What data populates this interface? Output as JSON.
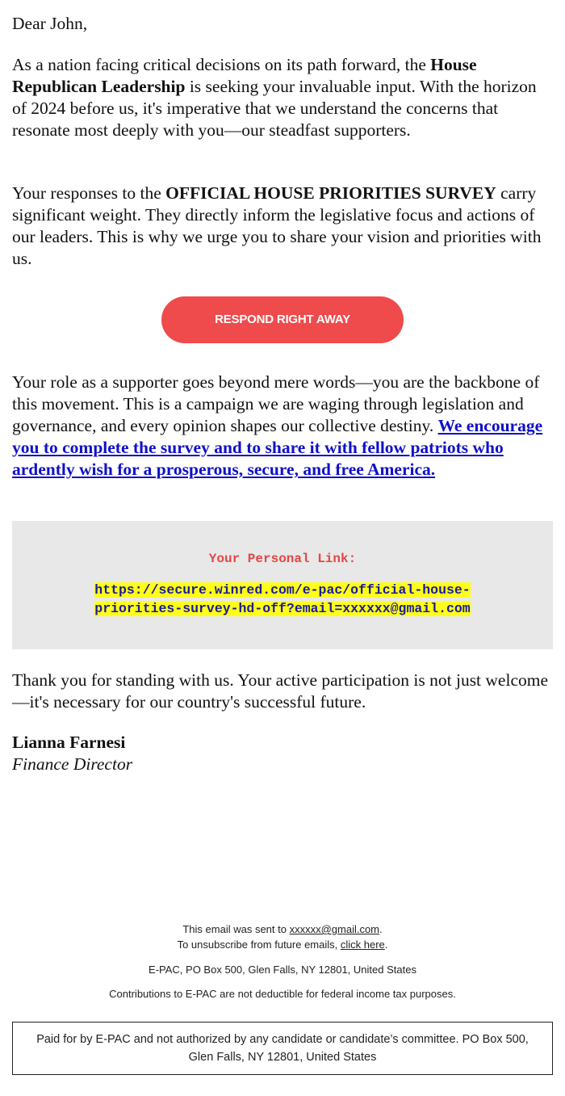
{
  "email": {
    "greeting": "Dear John,",
    "paragraph1": {
      "before_bold": "As a nation facing critical decisions on its path forward, the ",
      "bold": "House Republican Leadership",
      "after_bold": " is seeking your invaluable input. With the horizon of 2024 before us, it's imperative that we understand the concerns that resonate most deeply with you—our steadfast supporters."
    },
    "paragraph2": {
      "before_bold": "Your responses to the ",
      "bold": "OFFICIAL HOUSE PRIORITIES SURVEY",
      "after_bold": " carry significant weight. They directly inform the legislative focus and actions of our leaders. This is why we urge you to share your vision and priorities with us."
    },
    "cta_button": {
      "label": "RESPOND RIGHT AWAY",
      "color": "#ef4a4c"
    },
    "paragraph3": {
      "text": "Your role as a supporter goes beyond mere words—you are the backbone of this movement. This is a campaign we are waging through legislation and governance, and every opinion shapes our collective destiny. ",
      "link_text": "We encourage you to complete the survey and to share it with fellow patriots who ardently wish for a prosperous, secure, and free America."
    },
    "personal_link": {
      "label": "Your Personal Link:",
      "url": "https://secure.winred.com/e-pac/official-house-priorities-survey-hd-off?email=xxxxxx@gmail.com"
    },
    "paragraph4": "Thank you for standing with us. Your active participation is not just welcome—it's necessary for our country's successful future.",
    "signature": {
      "name": "Lianna Farnesi",
      "title": "Finance Director"
    }
  },
  "footer": {
    "sent_to_prefix": "This email was sent to ",
    "sent_to_email": "xxxxxx@gmail.com",
    "sent_to_suffix": ".",
    "unsubscribe_prefix": "To unsubscribe from future emails, ",
    "unsubscribe_link": "click here",
    "unsubscribe_suffix": ".",
    "address": "E-PAC, PO Box 500, Glen Falls, NY 12801, United States",
    "contributions_notice": "Contributions to E-PAC are not deductible for federal income tax purposes.",
    "disclaimer": "Paid for by E-PAC and not authorized by any candidate or candidate’s committee. PO Box 500, Glen Falls, NY 12801, United States"
  }
}
